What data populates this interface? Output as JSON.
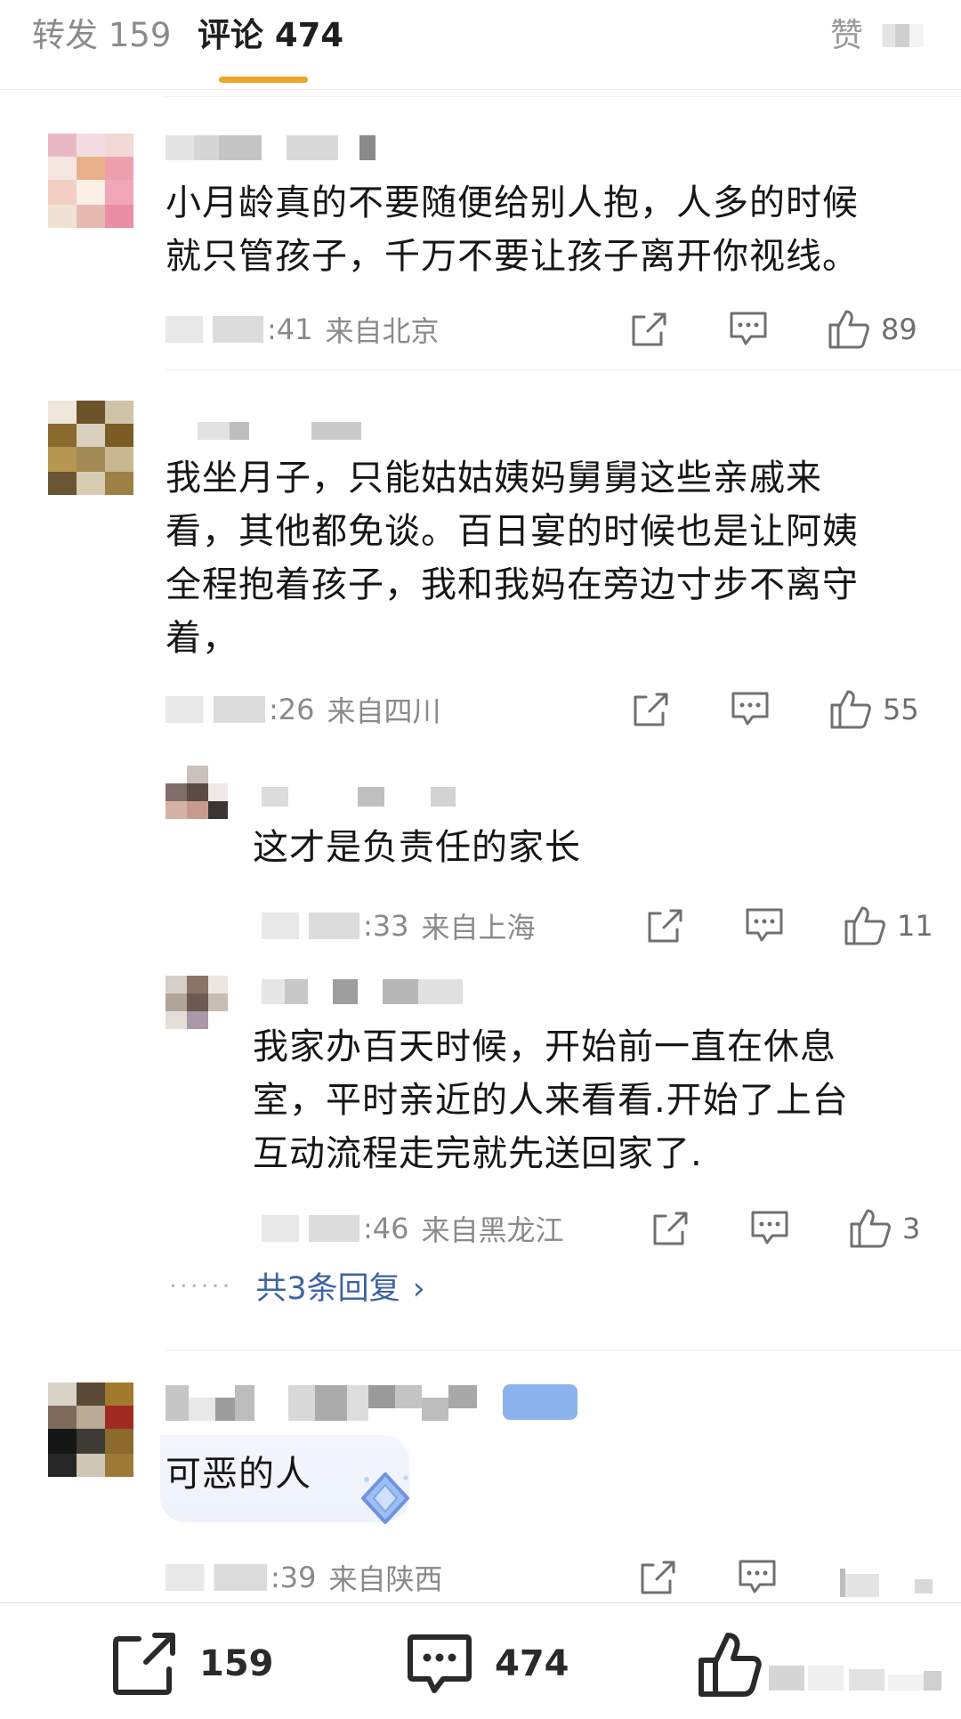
{
  "tabs": {
    "repost": "转发 159",
    "comments": "评论 474",
    "likes": "赞"
  },
  "comments": [
    {
      "text_lines": [
        "小月龄真的不要随便给别人抱，人多的时候",
        "就只管孩子，千万不要让孩子离开你视线。"
      ],
      "time": ":41",
      "location": "来自北京",
      "likes": "89"
    },
    {
      "text_lines": [
        "我坐月子，只能姑姑姨妈舅舅这些亲戚来",
        "看，其他都免谈。百日宴的时候也是让阿姨",
        "全程抱着孩子，我和我妈在旁边寸步不离守",
        "着，"
      ],
      "time": ":26",
      "location": "来自四川",
      "likes": "55",
      "replies": [
        {
          "text_lines": [
            "这才是负责任的家长"
          ],
          "time": ":33",
          "location": "来自上海",
          "likes": "11"
        },
        {
          "text_lines": [
            "我家办百天时候，开始前一直在休息",
            "室，平时亲近的人来看看.开始了上台",
            "互动流程走完就先送回家了."
          ],
          "time": ":46",
          "location": "来自黑龙江",
          "likes": "3"
        }
      ],
      "more_replies": "共3条回复"
    },
    {
      "text_lines": [
        "可恶的人"
      ],
      "time": ":39",
      "location": "来自陕西"
    }
  ],
  "bottom_bar": {
    "reposts": "159",
    "comments": "474"
  },
  "icons": {
    "share": "share-icon",
    "comment": "comment-icon",
    "like": "thumbs-up-icon",
    "chevron": "chevron-right-icon"
  },
  "colors": {
    "tab_indicator": "#f0a32b",
    "link": "#3d63a5",
    "badge": "#8db3ef"
  }
}
